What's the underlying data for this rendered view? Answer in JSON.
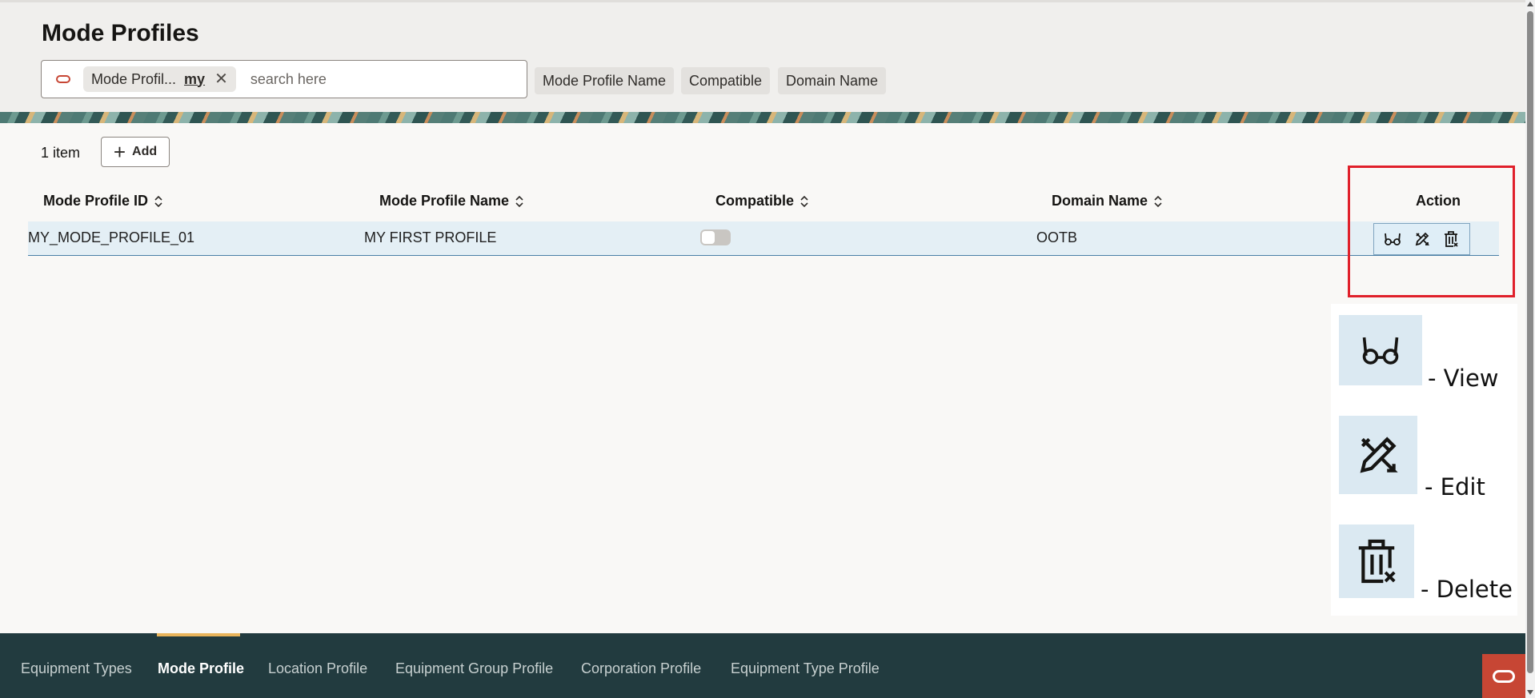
{
  "header": {
    "title": "Mode Profiles",
    "search": {
      "chip_label": "Mode Profil...",
      "chip_value": "my",
      "placeholder": "search here"
    },
    "filter_chips": [
      "Mode Profile Name",
      "Compatible",
      "Domain Name"
    ]
  },
  "toolbar": {
    "count_text": "1 item",
    "add_label": "Add"
  },
  "table": {
    "columns": [
      "Mode Profile ID",
      "Mode Profile Name",
      "Compatible",
      "Domain Name",
      "Action"
    ],
    "rows": [
      {
        "id": "MY_MODE_PROFILE_01",
        "name": "MY FIRST PROFILE",
        "compatible": false,
        "domain": "OOTB"
      }
    ]
  },
  "legend": {
    "view": "- View",
    "edit": "- Edit",
    "delete": "- Delete"
  },
  "bottom_nav": {
    "tabs": [
      "Equipment Types",
      "Mode Profile",
      "Location Profile",
      "Equipment Group Profile",
      "Corporation Profile",
      "Equipment Type Profile"
    ],
    "active": "Mode Profile"
  },
  "colors": {
    "brand_red": "#c74634",
    "nav_background": "#223b3f",
    "row_highlight": "#e4eff5",
    "annotation_red": "#e0202a"
  },
  "icons": [
    "oracle-icon",
    "close-icon",
    "plus-icon",
    "sort-icon",
    "glasses-icon",
    "pencil-ruler-icon",
    "trash-icon"
  ]
}
